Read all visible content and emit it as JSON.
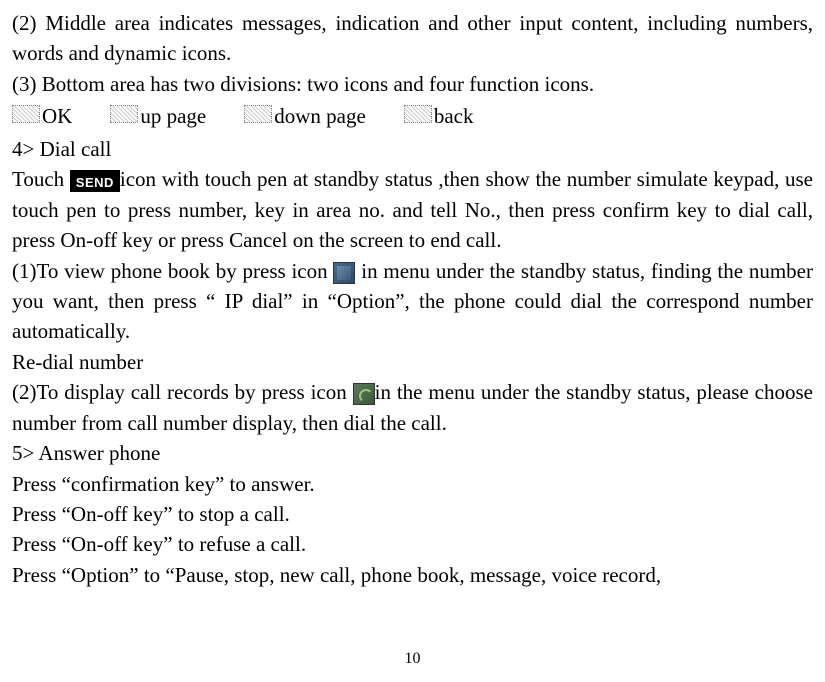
{
  "paragraphs": {
    "p1": "(2) Middle area indicates messages, indication and other input content, including numbers, words and dynamic icons.",
    "p2": "(3) Bottom area has two divisions: two icons and four function icons.",
    "icons": {
      "ok": "OK",
      "up": "up page",
      "down": "down page",
      "back": "back"
    },
    "s4_title": "4> Dial call",
    "s4_touch_pre": "Touch ",
    "s4_send_label": "SEND",
    "s4_touch_post": "icon with touch pen at standby status ,then show the number simulate keypad, use touch pen to press number, key in area no. and tell No., then press confirm key to dial call, press On-off key or press Cancel on the screen to end call.",
    "s4_1_pre": "(1)To view phone book by press icon ",
    "s4_1_post": " in menu under the standby status, finding the number you want, then press “ IP dial” in “Option”, the phone could dial the correspond number automatically.",
    "redial": "Re-dial number",
    "s4_2_pre": "(2)To display call records by press icon ",
    "s4_2_post": "in the menu under the standby status, please choose number from call number display, then dial the call.",
    "s5_title": "5> Answer phone",
    "s5_l1": "Press “confirmation key” to answer.",
    "s5_l2": "Press “On-off key” to stop a call.",
    "s5_l3": "Press “On-off key” to refuse a call.",
    "s5_l4": "Press “Option” to “Pause, stop, new call, phone book, message, voice record,"
  },
  "page_number": "10"
}
